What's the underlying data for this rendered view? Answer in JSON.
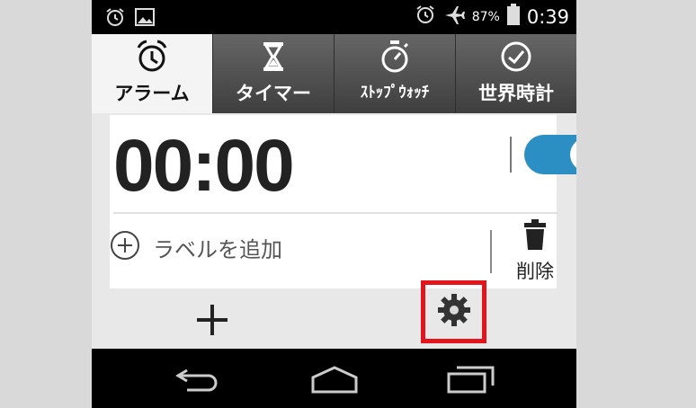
{
  "status_bar": {
    "left_icons": [
      "alarm-icon",
      "image-icon"
    ],
    "right_icons": [
      "alarm-icon",
      "airplane-icon",
      "battery-icon"
    ],
    "battery_percent": "87%",
    "time": "0:39"
  },
  "tabs": [
    {
      "label": "アラーム",
      "icon": "alarm-clock-icon",
      "active": true
    },
    {
      "label": "タイマー",
      "icon": "hourglass-icon",
      "active": false
    },
    {
      "label": "ｽﾄｯﾌﾟｳｫｯﾁ",
      "icon": "stopwatch-icon",
      "active": false
    },
    {
      "label": "世界時計",
      "icon": "clock-icon",
      "active": false
    }
  ],
  "alarm": {
    "time": "00:00",
    "toggle_label": "ON",
    "add_label_text": "ラベルを追加",
    "delete_label": "削除"
  },
  "colors": {
    "toggle_on": "#2b8fc4",
    "highlight": "#e3141b"
  },
  "actions": {
    "add_icon": "plus-icon",
    "settings_icon": "gear-icon"
  },
  "nav": {
    "icons": [
      "back-icon",
      "home-icon",
      "recent-apps-icon"
    ]
  }
}
